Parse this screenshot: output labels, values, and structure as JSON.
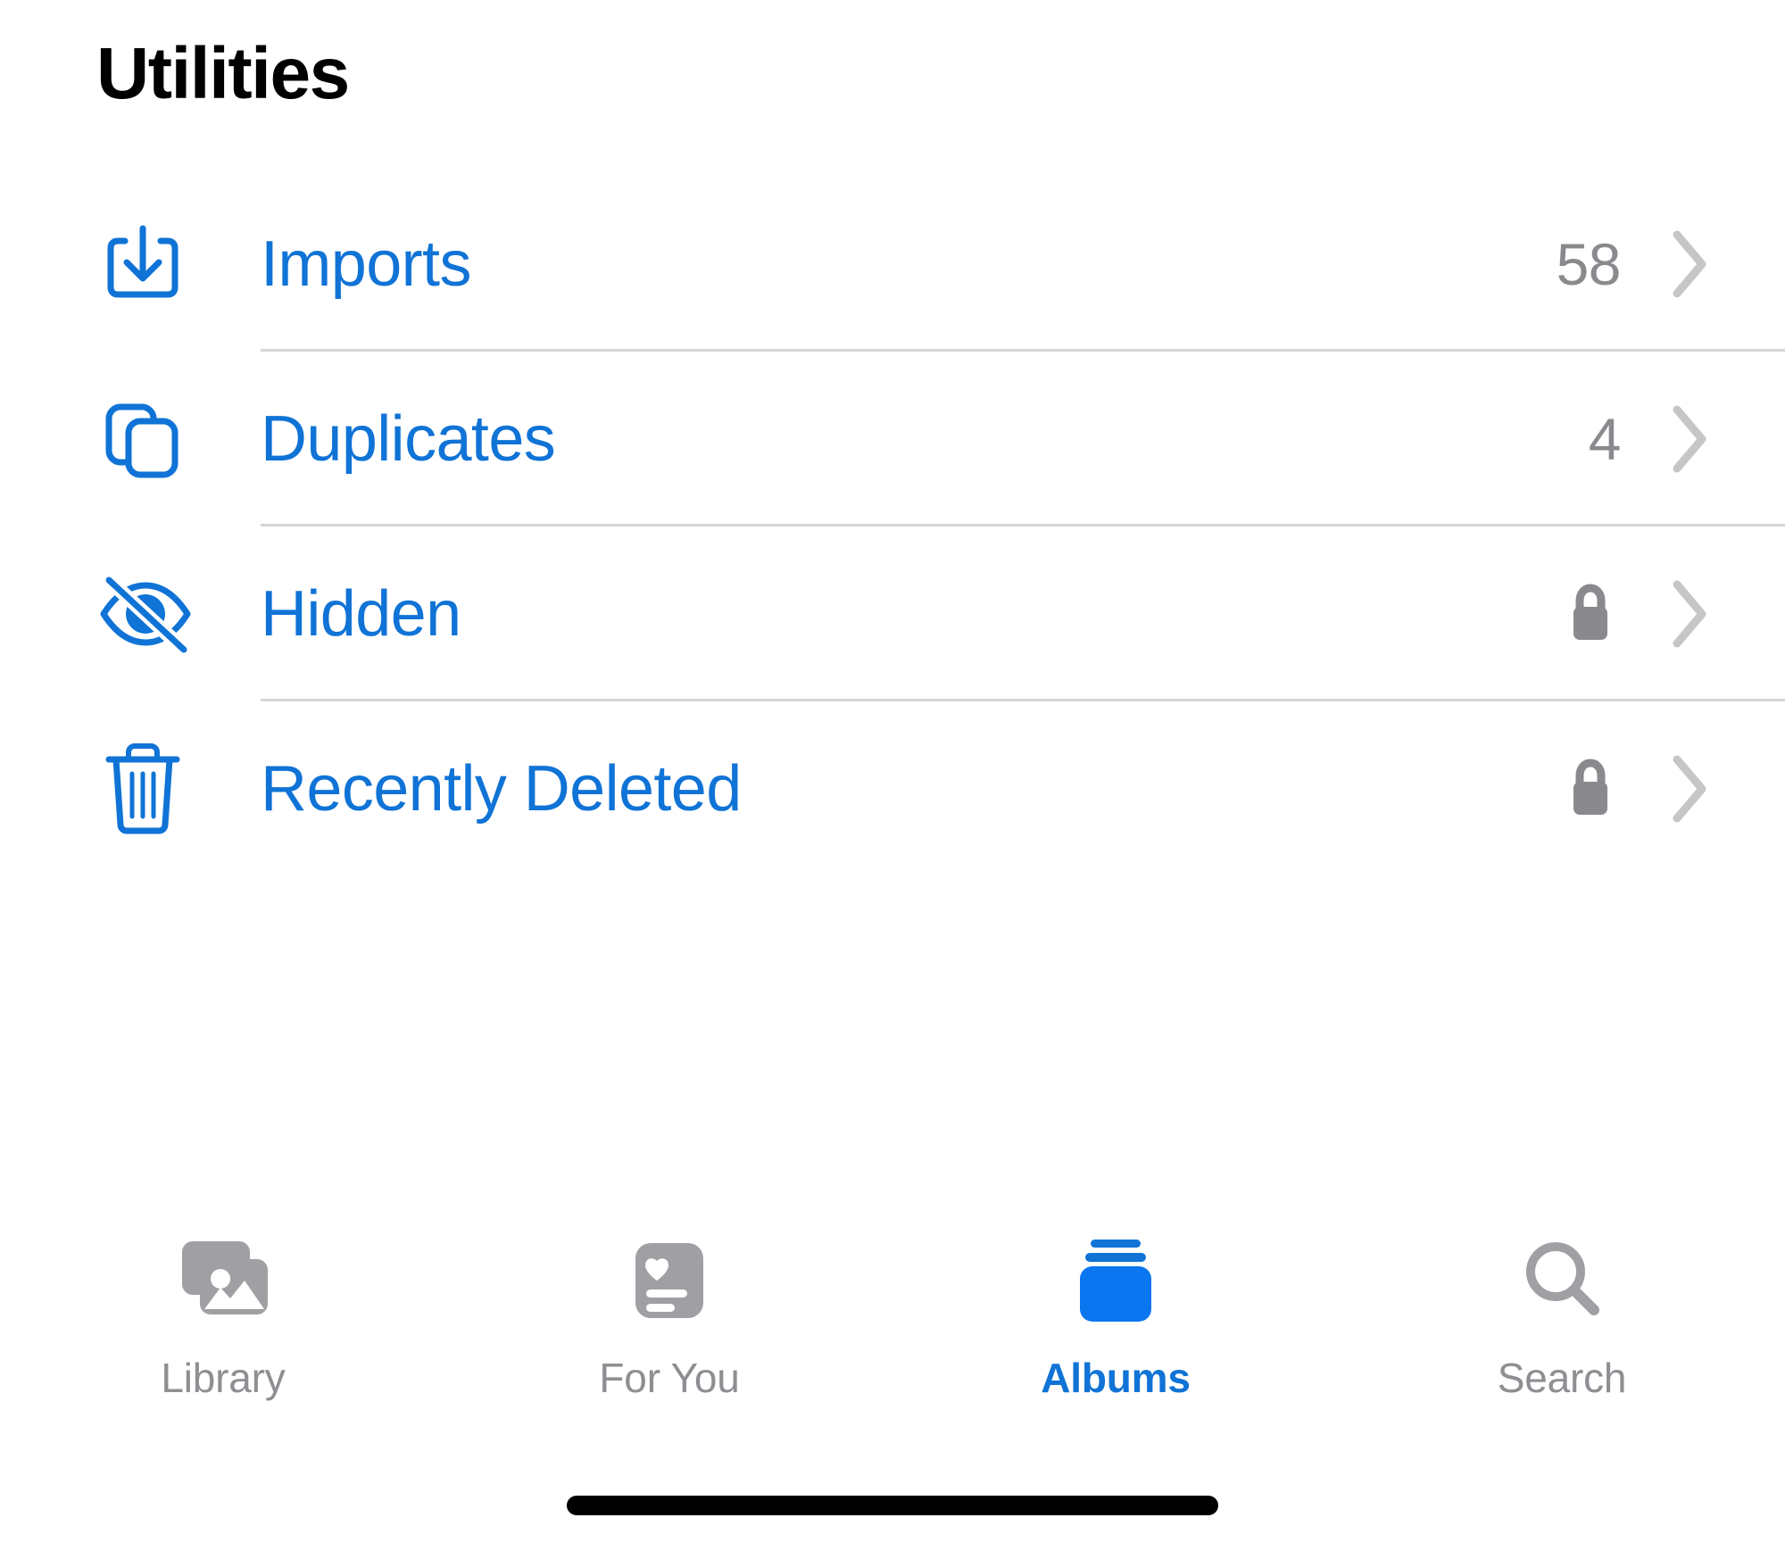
{
  "header": {
    "title": "Utilities"
  },
  "colors": {
    "accent_blue": "#1073D6",
    "label_gray": "#8e8e93",
    "chevron_gray": "#c6c6c8",
    "divider_gray": "#d6d6d8",
    "title_black": "#000000"
  },
  "list": {
    "rows": [
      {
        "label": "Imports",
        "icon": "square-and-arrow-down-icon",
        "count": "58",
        "locked": false,
        "chevron": "chevron-right-icon",
        "divider": true
      },
      {
        "label": "Duplicates",
        "icon": "duplicate-squares-icon",
        "count": "4",
        "locked": false,
        "chevron": "chevron-right-icon",
        "divider": true
      },
      {
        "label": "Hidden",
        "icon": "eye-slash-icon",
        "count": "",
        "locked": true,
        "chevron": "chevron-right-icon",
        "divider": true
      },
      {
        "label": "Recently Deleted",
        "icon": "trash-icon",
        "count": "",
        "locked": true,
        "chevron": "chevron-right-icon",
        "divider": false
      }
    ]
  },
  "tabbar": {
    "items": [
      {
        "label": "Library",
        "icon": "photo-stack-icon",
        "active": false
      },
      {
        "label": "For You",
        "icon": "heart-card-icon",
        "active": false
      },
      {
        "label": "Albums",
        "icon": "album-stack-icon",
        "active": true
      },
      {
        "label": "Search",
        "icon": "magnifier-icon",
        "active": false
      }
    ]
  },
  "home_indicator": {
    "present": true
  }
}
